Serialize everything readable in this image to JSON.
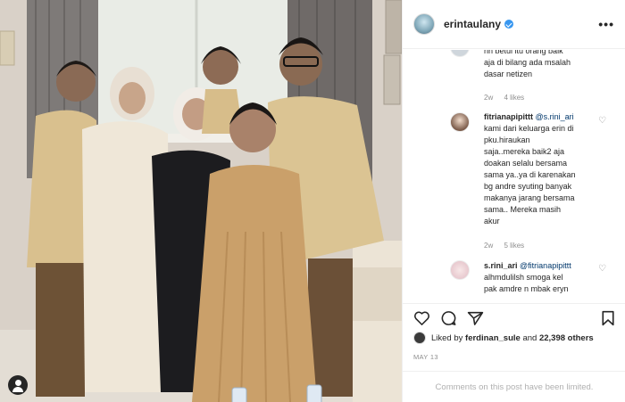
{
  "header": {
    "username": "erintaulany",
    "more_label": "•••"
  },
  "comments": [
    {
      "id": "c0",
      "username": "",
      "mention": "",
      "text_lines": [
        "nh betul itu orang baik\"",
        "aja di bilang ada msalah",
        "dasar netizen"
      ],
      "age": "2w",
      "likes": "4 likes"
    },
    {
      "id": "c1",
      "username": "fitrianapipittt",
      "mention": "@s.rini_ari",
      "text_lines": [
        "kami dari keluarga erin di",
        "pku.hiraukan",
        "saja..mereka baik2 aja",
        "doakan selalu bersama",
        "sama ya..ya di karenakan",
        "bg andre syuting banyak",
        "makanya jarang bersama",
        "sama.. Mereka masih",
        "akur"
      ],
      "age": "2w",
      "likes": "5 likes"
    },
    {
      "id": "c2",
      "username": "s.rini_ari",
      "mention": "@fitrianapipittt",
      "text_lines": [
        "alhmdulilsh smoga kel",
        "pak amdre n mbak eryn"
      ],
      "age": "",
      "likes": ""
    }
  ],
  "likes": {
    "prefix": "Liked by",
    "liker": "ferdinan_sule",
    "joiner": "and",
    "count": "22,398 others"
  },
  "date": "MAY 13",
  "comments_limited": "Comments on this post have been limited.",
  "colors": {
    "verified": "#3897f0",
    "mention": "#00376b",
    "meta": "#8e8e8e"
  }
}
